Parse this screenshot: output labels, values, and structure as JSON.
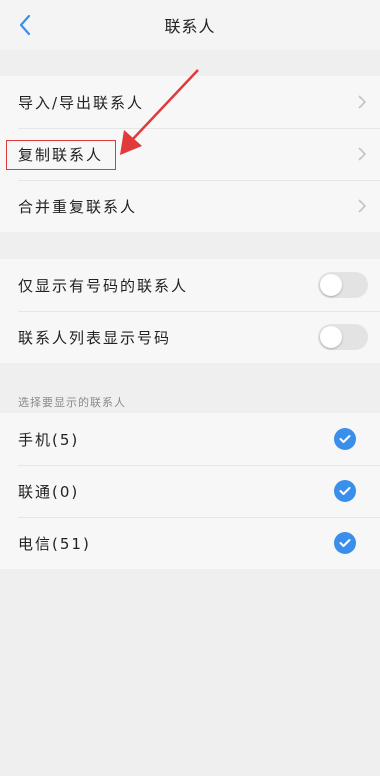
{
  "header": {
    "title": "联系人",
    "back_icon": "chevron-left-icon"
  },
  "group1": {
    "items": [
      {
        "label": "导入/导出联系人"
      },
      {
        "label": "复制联系人"
      },
      {
        "label": "合并重复联系人"
      }
    ]
  },
  "group2": {
    "items": [
      {
        "label": "仅显示有号码的联系人",
        "on": false
      },
      {
        "label": "联系人列表显示号码",
        "on": false
      }
    ]
  },
  "section_label": "选择要显示的联系人",
  "group3": {
    "items": [
      {
        "label": "手机(5)",
        "checked": true
      },
      {
        "label": "联通(0)",
        "checked": true
      },
      {
        "label": "电信(51)",
        "checked": true
      }
    ]
  },
  "colors": {
    "accent": "#3a8fea",
    "annotation": "#e03a3a"
  }
}
